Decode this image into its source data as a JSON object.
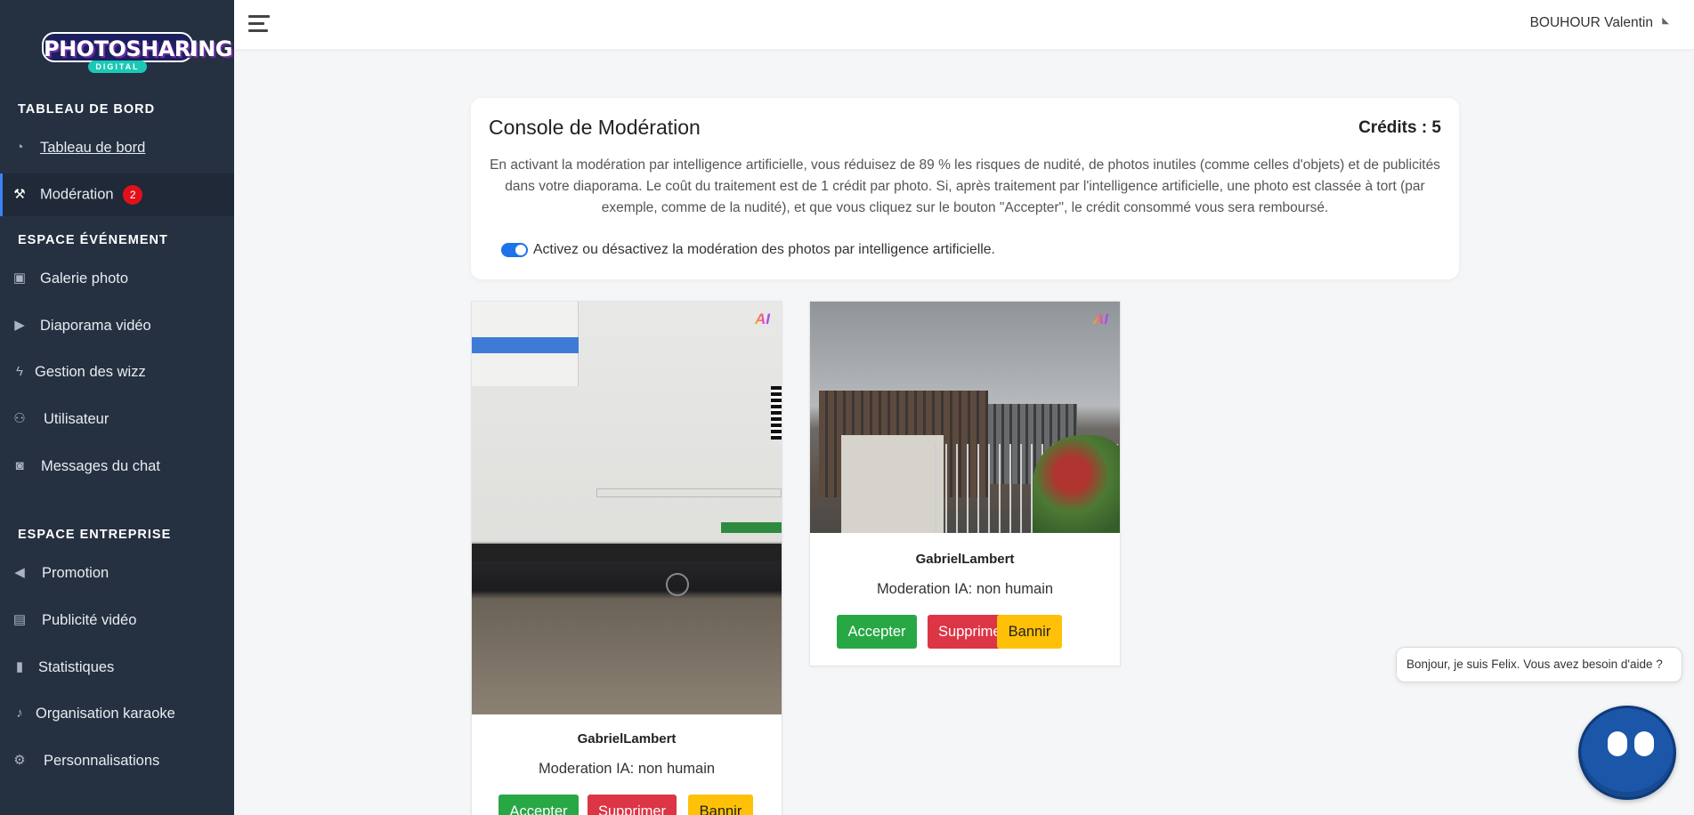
{
  "app": {
    "logo_text": "PHOTOSHARING",
    "logo_subtext": "DIGITAL"
  },
  "sidebar": {
    "sections": [
      {
        "title": "TABLEAU DE BORD",
        "items": [
          {
            "label": "Tableau de bord",
            "icon": "dashboard-icon"
          },
          {
            "label": "Modération",
            "icon": "gavel-icon",
            "badge": "2",
            "active": true
          }
        ]
      },
      {
        "title": "ESPACE ÉVÉNEMENT",
        "items": [
          {
            "label": "Galerie photo",
            "icon": "image-icon"
          },
          {
            "label": "Diaporama vidéo",
            "icon": "play-circle-icon"
          },
          {
            "label": "Gestion des wizz",
            "icon": "bolt-icon"
          },
          {
            "label": "Utilisateur",
            "icon": "users-icon"
          },
          {
            "label": "Messages du chat",
            "icon": "comments-icon"
          }
        ]
      },
      {
        "title": "ESPACE ENTREPRISE",
        "items": [
          {
            "label": "Promotion",
            "icon": "megaphone-icon"
          },
          {
            "label": "Publicité vidéo",
            "icon": "ad-icon"
          },
          {
            "label": "Statistiques",
            "icon": "bar-chart-icon"
          },
          {
            "label": "Organisation karaoke",
            "icon": "microphone-icon"
          },
          {
            "label": "Personnalisations",
            "icon": "cogs-icon"
          }
        ]
      }
    ]
  },
  "header": {
    "user_name": "BOUHOUR Valentin"
  },
  "console": {
    "title": "Console de Modération",
    "credits": "Crédits : 5",
    "description": "En activant la modération par intelligence artificielle, vous réduisez de 89 % les risques de nudité, de photos inutiles (comme celles d'objets) et de publicités dans votre diaporama. Le coût du traitement est de 1 crédit par photo. Si, après traitement par l'intelligence artificielle, une photo est classée à tort (par exemple, comme de la nudité), et que vous cliquez sur le bouton \"Accepter\", le crédit consommé vous sera remboursé.",
    "toggle_label": "Activez ou désactivez la modération des photos par intelligence artificielle.",
    "toggle_on": true
  },
  "cards": [
    {
      "author": "GabrielLambert",
      "moderation": "Moderation IA: non humain",
      "accept": "Accepter",
      "delete": "Supprimer",
      "ban": "Bannir",
      "ai_badge": "AI"
    },
    {
      "author": "GabrielLambert",
      "moderation": "Moderation IA: non humain",
      "accept": "Accepter",
      "delete": "Supprimer",
      "ban": "Bannir",
      "ai_badge": "AI"
    }
  ],
  "chat": {
    "bubble": "Bonjour, je suis Felix. Vous avez besoin d'aide ?"
  },
  "colors": {
    "sidebar_bg": "#253041",
    "accept": "#28a745",
    "delete": "#dc3545",
    "ban": "#ffc107",
    "badge": "#e3101c",
    "toggle": "#1e73e8"
  }
}
